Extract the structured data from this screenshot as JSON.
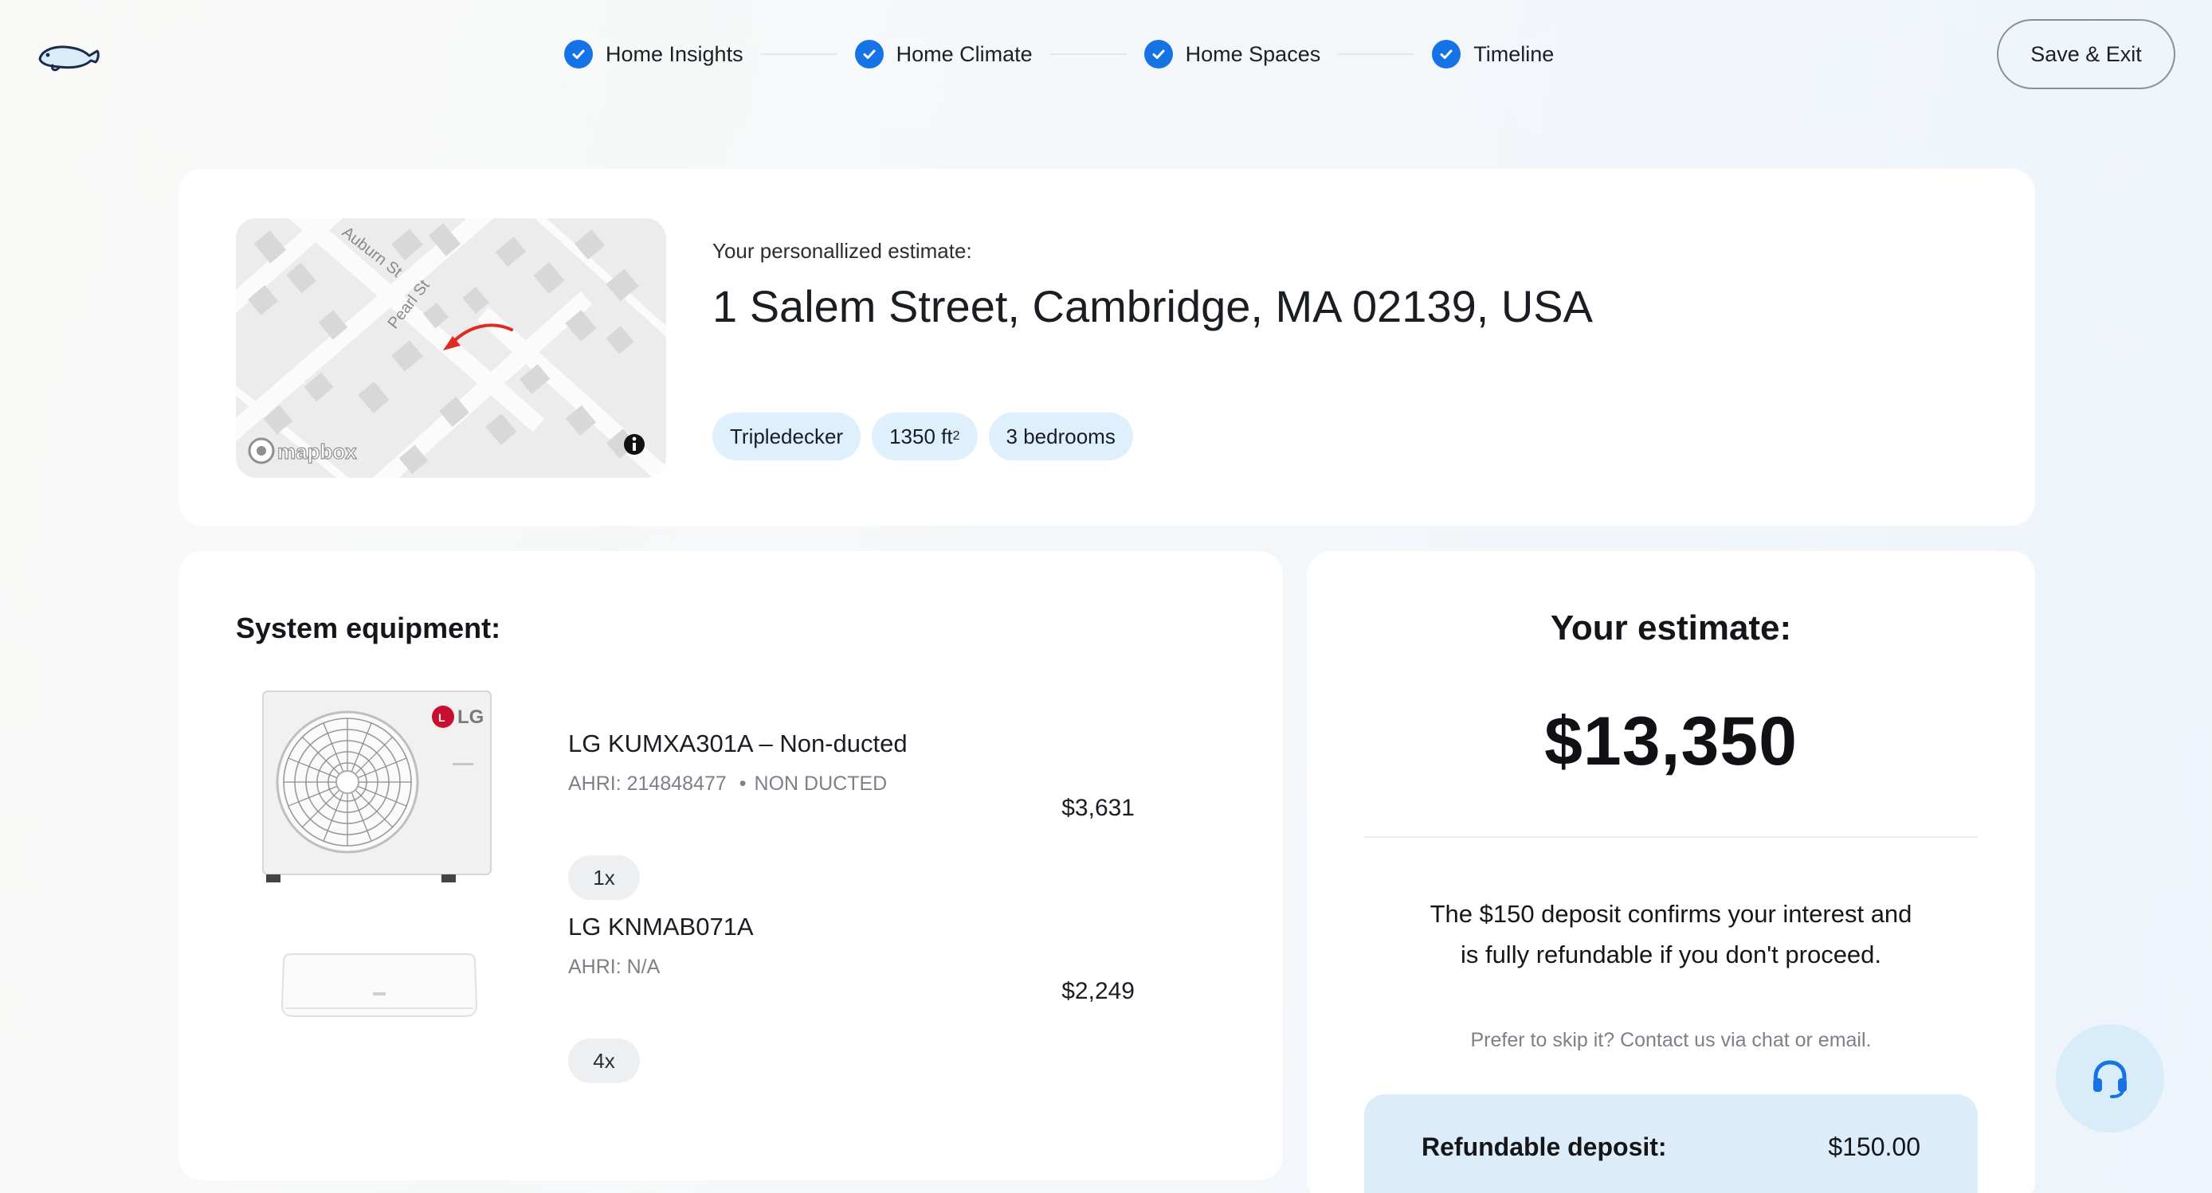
{
  "brand": {
    "logo_icon": "manatee-logo-icon",
    "accent_color": "#1673e6"
  },
  "steps": [
    {
      "label": "Home Insights",
      "status": "complete"
    },
    {
      "label": "Home Climate",
      "status": "complete"
    },
    {
      "label": "Home Spaces",
      "status": "complete"
    },
    {
      "label": "Timeline",
      "status": "complete"
    }
  ],
  "header": {
    "save_exit_label": "Save & Exit"
  },
  "property": {
    "estimate_label": "Your personallized estimate:",
    "address": "1 Salem Street, Cambridge, MA 02139, USA",
    "tags": {
      "type": "Tripledecker",
      "area": "1350 ft",
      "area_unit_sup": "2",
      "bedrooms": "3 bedrooms"
    },
    "map": {
      "streets": [
        "Auburn St",
        "Pearl St"
      ],
      "attribution": "mapbox",
      "info_icon": "info-icon"
    }
  },
  "equipment": {
    "title": "System equipment:",
    "items": [
      {
        "name": "LG KUMXA301A – Non-ducted",
        "ahri": "AHRI: 214848477",
        "type": "NON DUCTED",
        "price": "$3,631",
        "qty": "1x",
        "image": "outdoor-unit-image",
        "brand_mark": "LG"
      },
      {
        "name": "LG KNMAB071A",
        "ahri": "AHRI: N/A",
        "type": "",
        "price": "$2,249",
        "qty": "4x",
        "image": "indoor-unit-image"
      }
    ]
  },
  "estimate": {
    "title": "Your estimate:",
    "amount": "$13,350",
    "deposit_text": "The $150 deposit confirms your interest and is fully refundable if you don't proceed.",
    "deposit_sub": "Prefer to skip it? Contact us via chat or email.",
    "deposit_label": "Refundable deposit:",
    "deposit_value": "$150.00"
  },
  "support": {
    "icon": "headset-icon"
  }
}
